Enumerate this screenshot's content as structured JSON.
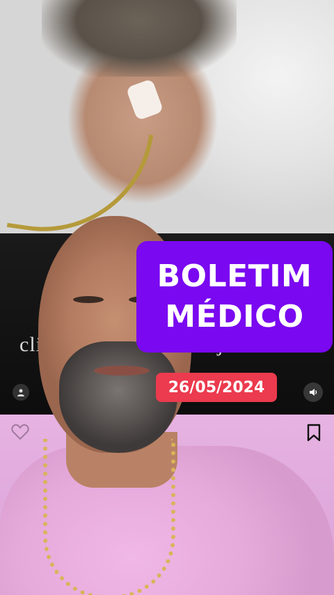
{
  "overlay": {
    "title_line1": "BOLETIM",
    "title_line2": "MÉDICO",
    "title_bg": "#7a08f0",
    "date": "26/05/2024",
    "date_bg": "#ec3a4e"
  },
  "icons": {
    "user": "user-icon",
    "sound": "speaker-icon",
    "like": "heart-icon",
    "save": "bookmark-icon"
  }
}
